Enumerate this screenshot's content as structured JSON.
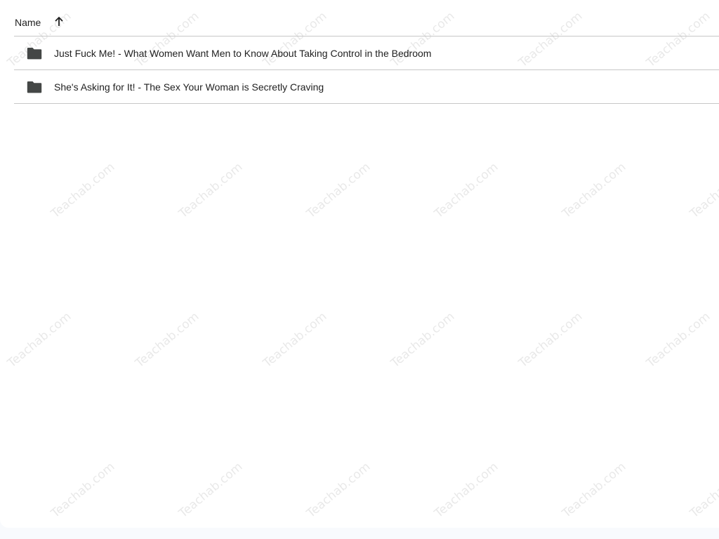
{
  "header": {
    "name_label": "Name",
    "sort_icon": "arrow-up-icon"
  },
  "files": [
    {
      "icon": "folder-icon",
      "name": "Just Fuck Me! - What Women Want Men to Know About Taking Control in the Bedroom"
    },
    {
      "icon": "folder-icon",
      "name": "She's Asking for It! - The Sex Your Woman is Secretly Craving"
    }
  ],
  "watermark": {
    "text": "Teachab.com",
    "color": "#000000"
  },
  "colors": {
    "divider": "#c7c7c7",
    "icon": "#444746",
    "text": "#1f1f1f",
    "page_background": "#f8fafd"
  }
}
